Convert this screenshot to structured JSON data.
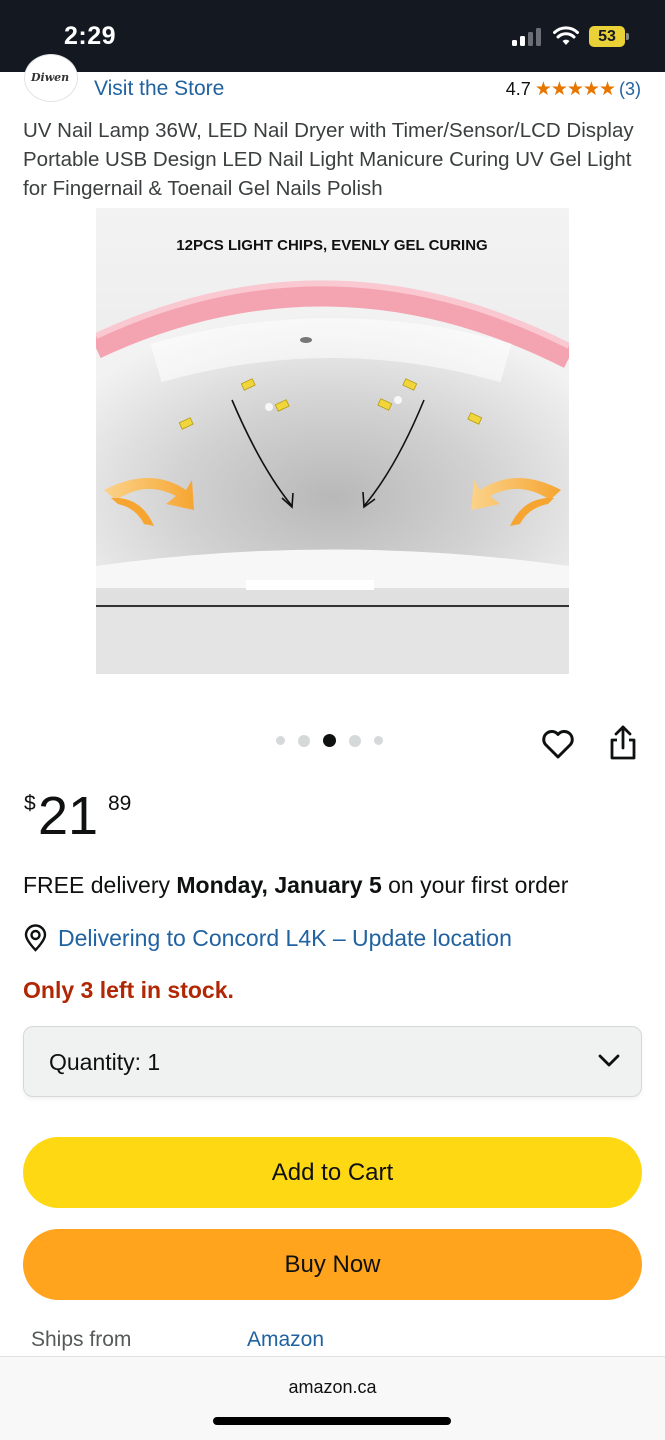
{
  "status_bar": {
    "time": "2:29",
    "battery": "53"
  },
  "store": {
    "visit_label": "Visit the Store",
    "rating_value": "4.7",
    "stars": "★★★★★",
    "rating_count": "(3)",
    "star_fill": 0.94,
    "logo_text": "Diwen"
  },
  "product": {
    "title": "UV Nail Lamp 36W, LED Nail Dryer with Timer/Sensor/LCD Display Portable USB Design LED Nail Light Manicure Curing UV Gel Light for Fingernail & Toenail Gel Nails Polish",
    "image_caption": "12PCS LIGHT CHIPS, EVENLY GEL CURING",
    "carousel": {
      "total": 5,
      "active_index": 2
    }
  },
  "price": {
    "symbol": "$",
    "whole": "21",
    "fraction": "89"
  },
  "delivery": {
    "prefix": "FREE delivery ",
    "date": "Monday, January 5",
    "suffix": " on your first order",
    "location": "Delivering to Concord L4K – Update location"
  },
  "stock": "Only 3 left in stock.",
  "quantity": {
    "label": "Quantity:",
    "value": "1",
    "display": "Quantity:  1"
  },
  "buttons": {
    "add_to_cart": "Add to Cart",
    "buy_now": "Buy Now"
  },
  "ships_from": {
    "label": "Ships from",
    "value": "Amazon"
  },
  "browser": {
    "url": "amazon.ca"
  },
  "colors": {
    "link": "#2162a1",
    "stock_red": "#b12704",
    "add_to_cart": "#ffd814",
    "buy_now": "#ffa41c",
    "star": "#e77600"
  },
  "icons": [
    "wifi-icon",
    "signal-icon",
    "battery-icon",
    "heart-icon",
    "share-icon",
    "location-pin-icon",
    "chevron-down-icon"
  ]
}
